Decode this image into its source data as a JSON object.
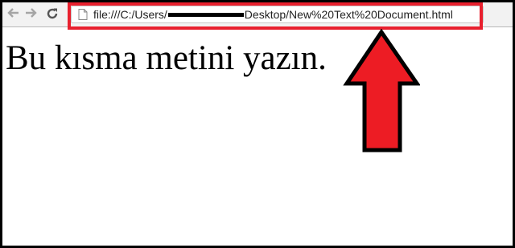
{
  "browser": {
    "nav_icons": [
      "back-arrow-icon",
      "forward-arrow-icon",
      "reload-icon"
    ],
    "address_bar": {
      "icon": "page-icon",
      "url_before_redaction": "file:///C:/Users/",
      "url_after_redaction": "Desktop/New%20Text%20Document.html"
    }
  },
  "page": {
    "body_text": "Bu kısma metini yazın."
  },
  "annotation": {
    "highlight_color": "#e8202e",
    "arrow_color": "#ed1c24",
    "arrow_direction": "up"
  }
}
